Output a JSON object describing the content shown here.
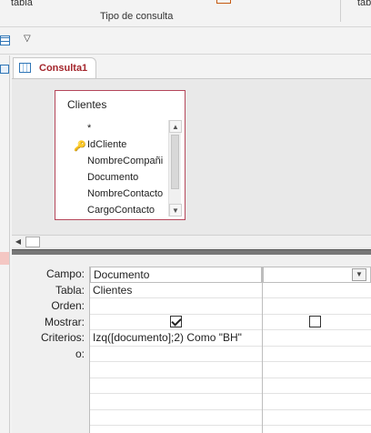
{
  "ribbon": {
    "tab_left_label": "tabla",
    "group_label": "Tipo de consulta",
    "tab_right_label": "tab"
  },
  "document_tab": {
    "title": "Consulta1"
  },
  "field_list": {
    "table_name": "Clientes",
    "fields": [
      "*",
      "IdCliente",
      "NombreCompañi",
      "Documento",
      "NombreContacto",
      "CargoContacto"
    ],
    "primary_key_field": "IdCliente"
  },
  "grid": {
    "row_labels": [
      "Campo:",
      "Tabla:",
      "Orden:",
      "Mostrar:",
      "Criterios:",
      "o:"
    ],
    "columns": [
      {
        "campo": "Documento",
        "tabla": "Clientes",
        "orden": "",
        "mostrar": true,
        "criterios": "Izq([documento];2) Como \"BH\"",
        "o": ""
      },
      {
        "campo": "",
        "tabla": "",
        "orden": "",
        "mostrar": false,
        "criterios": "",
        "o": ""
      }
    ]
  },
  "colors": {
    "tab_title": "#a4262c",
    "field_list_border": "#b5475a",
    "accent_blue": "#2e75b6"
  }
}
